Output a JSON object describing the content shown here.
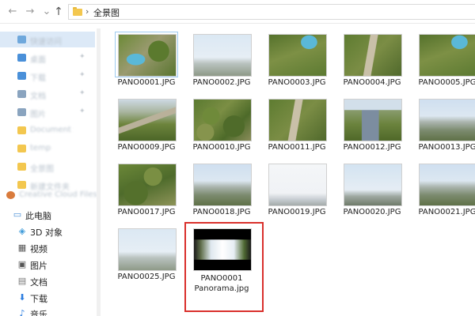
{
  "address": {
    "separator": "›",
    "path": "全景图"
  },
  "nav": {
    "back": "←",
    "forward": "→",
    "recent": "⌄",
    "up": "↑"
  },
  "sidebar": {
    "blurred_items": [
      {
        "label": "快速访问",
        "color": "#6fa8dc"
      },
      {
        "label": "桌面",
        "color": "#4a90d9"
      },
      {
        "label": "下载",
        "color": "#4a90d9"
      },
      {
        "label": "文档",
        "color": "#8aa4bf"
      },
      {
        "label": "图片",
        "color": "#8aa4bf"
      },
      {
        "label": "Document",
        "color": "#f3c74f"
      },
      {
        "label": "temp",
        "color": "#f3c74f"
      },
      {
        "label": "全景图",
        "color": "#f3c74f"
      },
      {
        "label": "新建文件夹",
        "color": "#f3c74f"
      },
      {
        "label": "Creative Cloud Files",
        "color": "#d97b3c"
      }
    ],
    "pc": {
      "label": "此电脑"
    },
    "items": [
      {
        "label": "3D 对象",
        "icon": "cube-icon"
      },
      {
        "label": "视频",
        "icon": "video-icon"
      },
      {
        "label": "图片",
        "icon": "picture-icon"
      },
      {
        "label": "文档",
        "icon": "document-icon"
      },
      {
        "label": "下载",
        "icon": "download-icon"
      },
      {
        "label": "音乐",
        "icon": "music-icon"
      }
    ]
  },
  "files": [
    {
      "name": "PANO0001.JPG"
    },
    {
      "name": "PANO0002.JPG"
    },
    {
      "name": "PANO0003.JPG"
    },
    {
      "name": "PANO0004.JPG"
    },
    {
      "name": "PANO0005.JPG"
    },
    {
      "name": "PANO0009.JPG"
    },
    {
      "name": "PANO0010.JPG"
    },
    {
      "name": "PANO0011.JPG"
    },
    {
      "name": "PANO0012.JPG"
    },
    {
      "name": "PANO0013.JPG"
    },
    {
      "name": "PANO0017.JPG"
    },
    {
      "name": "PANO0018.JPG"
    },
    {
      "name": "PANO0019.JPG"
    },
    {
      "name": "PANO0020.JPG"
    },
    {
      "name": "PANO0021.JPG"
    },
    {
      "name": "PANO0025.JPG"
    }
  ],
  "highlighted_file": {
    "line1": "PANO0001",
    "line2": "Panorama.jpg",
    "frame_color": "#d9302c"
  }
}
